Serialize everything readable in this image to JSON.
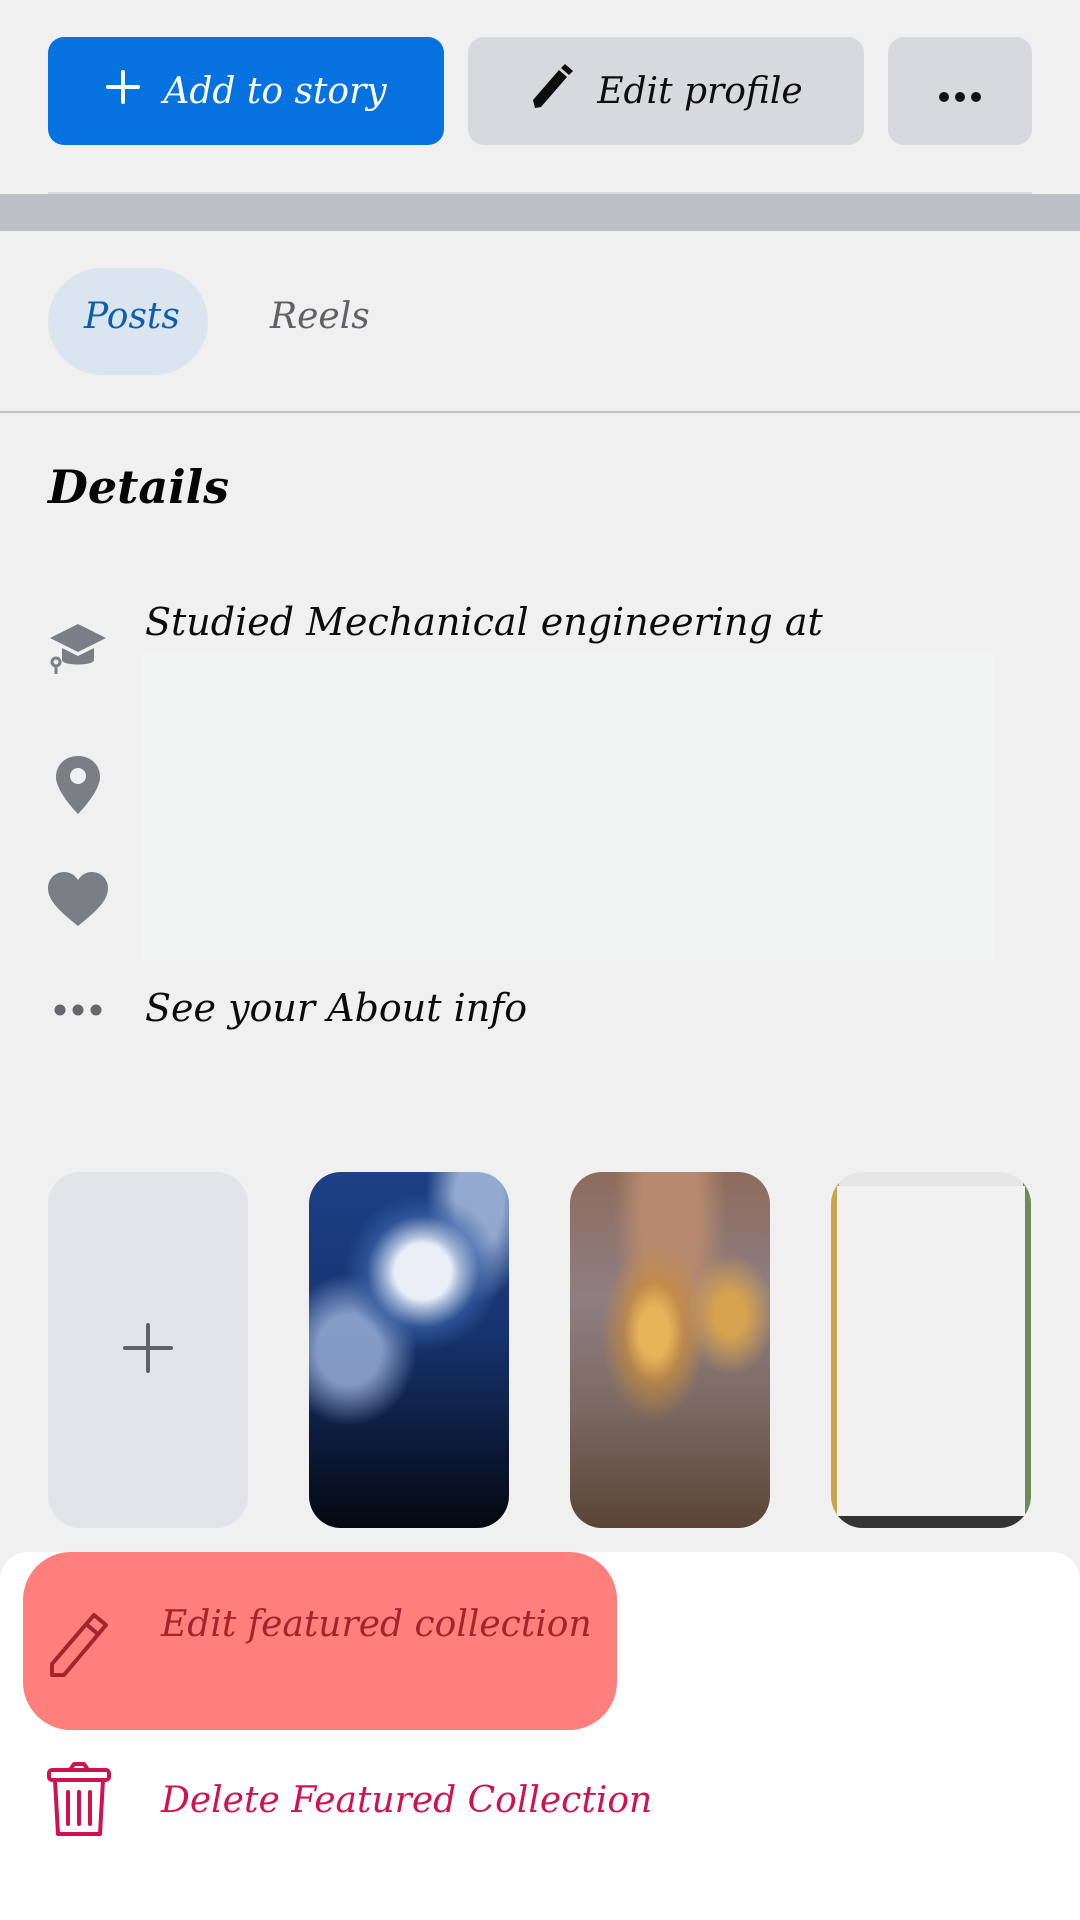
{
  "profile_actions": {
    "add_to_story": {
      "label": "Add to story",
      "icon": "plus-icon",
      "color": "#0672e0"
    },
    "edit_profile": {
      "label": "Edit profile",
      "icon": "pencil-icon"
    },
    "more": {
      "icon": "more-horizontal-icon"
    }
  },
  "tabs": [
    {
      "label": "Posts",
      "active": true
    },
    {
      "label": "Reels",
      "active": false
    }
  ],
  "details": {
    "title": "Details",
    "items": [
      {
        "icon": "graduation-cap-icon",
        "text": "Studied Mechanical engineering at"
      },
      {
        "icon": "location-pin-icon",
        "text": ""
      },
      {
        "icon": "heart-icon",
        "text": ""
      },
      {
        "icon": "more-dots-icon",
        "text": "See your About info"
      }
    ]
  },
  "featured": {
    "cards": [
      {
        "type": "add",
        "icon": "plus-icon"
      },
      {
        "type": "image",
        "description": "Full moon in a starry night sky with clouds"
      },
      {
        "type": "image",
        "description": "Bronze relief of seated Buddha with disciples"
      },
      {
        "type": "image",
        "description": "Redacted photo"
      }
    ]
  },
  "bottom_sheet": {
    "items": [
      {
        "label": "Edit featured collection",
        "icon": "pencil-outline-icon",
        "highlighted": true,
        "color": "#a1252b",
        "background": "#ff7f7c"
      },
      {
        "label": "Delete Featured Collection",
        "icon": "trash-icon",
        "color": "#d0134e"
      }
    ]
  }
}
